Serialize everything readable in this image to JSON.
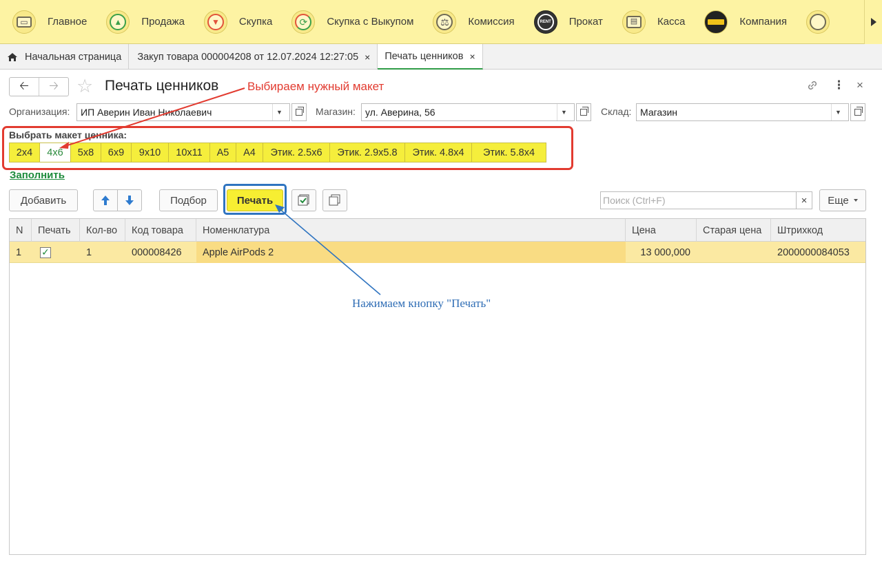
{
  "sections": [
    {
      "label": "Главное",
      "icon": "main-register-icon",
      "glyph": "▭"
    },
    {
      "label": "Продажа",
      "icon": "cart-icon",
      "glyph": "🛒"
    },
    {
      "label": "Скупка",
      "icon": "cart-down-icon",
      "glyph": "🛒"
    },
    {
      "label": "Скупка с Выкупом",
      "icon": "cycle-arrows-icon",
      "glyph": "⟳"
    },
    {
      "label": "Комиссия",
      "icon": "scales-icon",
      "glyph": "⚖"
    },
    {
      "label": "Прокат",
      "icon": "rent-icon",
      "glyph": "RENT"
    },
    {
      "label": "Касса",
      "icon": "cash-register-icon",
      "glyph": "▤"
    },
    {
      "label": "Компания",
      "icon": "company-logo-icon",
      "glyph": "●"
    }
  ],
  "tabs": {
    "home": "Начальная страница",
    "purchase": "Закуп товара 000004208 от 12.07.2024 12:27:05",
    "price_print": "Печать ценников",
    "close_glyph": "×"
  },
  "form": {
    "title": "Печать ценников",
    "annotation_layout": "Выбираем нужный макет",
    "annotation_print": "Нажимаем кнопку \"Печать\"",
    "org_label": "Организация:",
    "org_value": "ИП Аверин Иван Николаевич",
    "shop_label": "Магазин:",
    "shop_value": "ул. Аверина, 56",
    "warehouse_label": "Склад:",
    "warehouse_value": "Магазин",
    "layout_title": "Выбрать макет ценника:",
    "layouts": [
      "2x4",
      "4x6",
      "5x8",
      "6x9",
      "9x10",
      "10x11",
      "A5",
      "A4",
      "Этик. 2.5x6",
      "Этик. 2.9x5.8",
      "Этик. 4.8x4",
      "Этик. 5.8x4"
    ],
    "selected_layout": "4x6",
    "fill_link": "Заполнить"
  },
  "toolbar": {
    "add": "Добавить",
    "pick": "Подбор",
    "print": "Печать",
    "search_placeholder": "Поиск (Ctrl+F)",
    "search_clear": "×",
    "more": "Еще"
  },
  "table": {
    "columns": [
      "N",
      "Печать",
      "Кол-во",
      "Код товара",
      "Номенклатура",
      "Цена",
      "Старая цена",
      "Штрихкод"
    ],
    "rows": [
      {
        "n": "1",
        "print": true,
        "qty": "1",
        "code": "000008426",
        "name": "Apple AirPods 2",
        "price": "13 000,000",
        "old_price": "",
        "barcode": "2000000084053"
      }
    ]
  },
  "colors": {
    "accent_green": "#1e8b3c",
    "annotation_red": "#e23b30",
    "annotation_blue": "#2f74c0",
    "print_button": "#f7ee32",
    "topbar": "#fdf3a3"
  }
}
